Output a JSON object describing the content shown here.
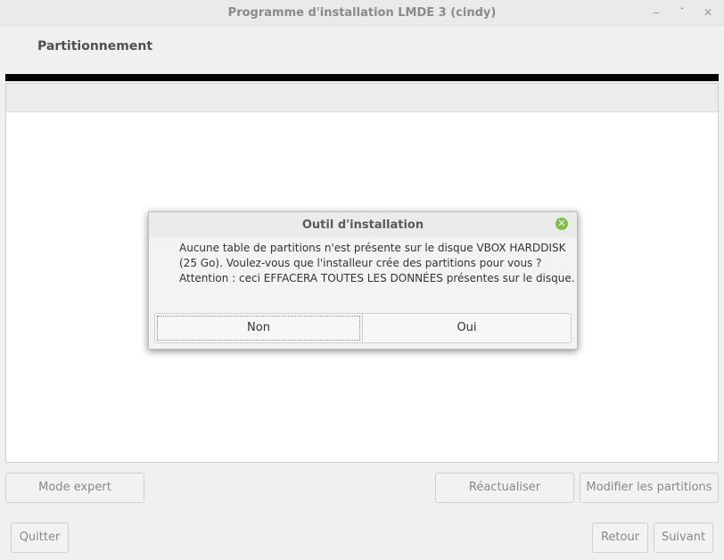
{
  "window": {
    "title": "Programme d'installation LMDE 3 (cindy)",
    "minimize_glyph": "‒",
    "maximize_glyph": "˘",
    "close_glyph": "✕"
  },
  "page": {
    "title": "Partitionnement"
  },
  "toolbar": {
    "expert_label": "Mode expert",
    "refresh_label": "Réactualiser",
    "edit_label": "Modifier les partitions"
  },
  "footer": {
    "quit_label": "Quitter",
    "back_label": "Retour",
    "next_label": "Suivant"
  },
  "dialog": {
    "title": "Outil d'installation",
    "close_glyph": "✕",
    "message_lines": [
      "Aucune table de partitions n'est présente sur le disque VBOX HARDDISK",
      "(25 Go). Voulez-vous que l'installeur crée des partitions pour vous ?",
      "Attention : ceci EFFACERA TOUTES LES DONNÉES présentes sur le disque."
    ],
    "no_label": "Non",
    "yes_label": "Oui"
  },
  "colors": {
    "progress": "#000000",
    "close_icon": "#7fbf4a"
  },
  "icons": [
    "minimize-icon",
    "maximize-icon",
    "close-icon",
    "dialog-close-icon"
  ]
}
